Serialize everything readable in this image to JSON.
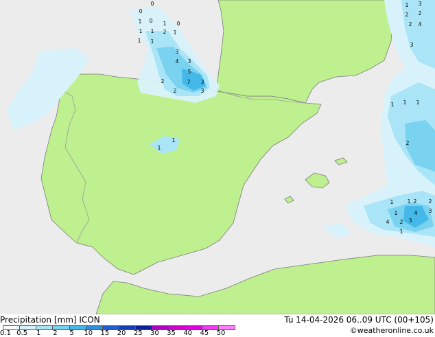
{
  "map": {
    "colors": {
      "sea": "#ececec",
      "land": "#bff08f",
      "border": "#9a9a9a",
      "coast": "#7a7a7a"
    },
    "precip_values": [
      [
        "0",
        "loc1"
      ],
      [
        "0",
        "loc2"
      ],
      [
        "0",
        "loc3"
      ],
      [
        "1",
        "loc4"
      ],
      [
        "1",
        "loc5"
      ],
      [
        "0",
        "loc6"
      ],
      [
        "1",
        "loc7"
      ],
      [
        "1",
        "loc8"
      ],
      [
        "2",
        "loc9"
      ],
      [
        "1",
        "loc10"
      ],
      [
        "1",
        "loc11"
      ],
      [
        "1",
        "loc12"
      ],
      [
        "3",
        "loc13"
      ],
      [
        "4",
        "loc14"
      ],
      [
        "3",
        "loc15"
      ],
      [
        "5",
        "loc16"
      ],
      [
        "7",
        "loc17"
      ],
      [
        "3",
        "loc18"
      ],
      [
        "2",
        "loc19"
      ],
      [
        "2",
        "loc20"
      ],
      [
        "3",
        "loc21"
      ],
      [
        "1",
        "loc22"
      ],
      [
        "1",
        "loc23"
      ],
      [
        "1",
        "loc24"
      ],
      [
        "2",
        "loc25"
      ],
      [
        "3",
        "loc26"
      ],
      [
        "2",
        "loc27"
      ],
      [
        "4",
        "loc28"
      ],
      [
        "2",
        "loc29"
      ],
      [
        "3",
        "loc30"
      ],
      [
        "1",
        "loc31"
      ],
      [
        "2",
        "loc32"
      ],
      [
        "1",
        "loc33"
      ],
      [
        "1",
        "loc34"
      ],
      [
        "1",
        "loc35"
      ],
      [
        "4",
        "loc36"
      ],
      [
        "1",
        "loc37"
      ],
      [
        "2",
        "loc38"
      ],
      [
        "2",
        "loc39"
      ],
      [
        "3",
        "loc40"
      ],
      [
        "3",
        "loc41"
      ],
      [
        "4",
        "loc42"
      ],
      [
        "2",
        "loc43"
      ],
      [
        "1",
        "loc44"
      ],
      [
        "1",
        "loc45"
      ]
    ]
  },
  "footer": {
    "title": "Precipitation [mm] ICON",
    "datetime": "Tu 14-04-2026 06..09 UTC (00+105)",
    "credit": "©weatheronline.co.uk",
    "scale": {
      "labels": [
        "0.1",
        "0.5",
        "1",
        "2",
        "5",
        "10",
        "15",
        "20",
        "25",
        "30",
        "35",
        "40",
        "45",
        "50"
      ],
      "colors": [
        "#f5fbff",
        "#d8f2fb",
        "#a9e4f7",
        "#78d2f0",
        "#44b8e8",
        "#2f8fe0",
        "#1f5fd2",
        "#173bb8",
        "#0f1f9a",
        "#b000c8",
        "#d000d0",
        "#e000e0",
        "#f03cf0",
        "#ff80ff"
      ]
    }
  }
}
